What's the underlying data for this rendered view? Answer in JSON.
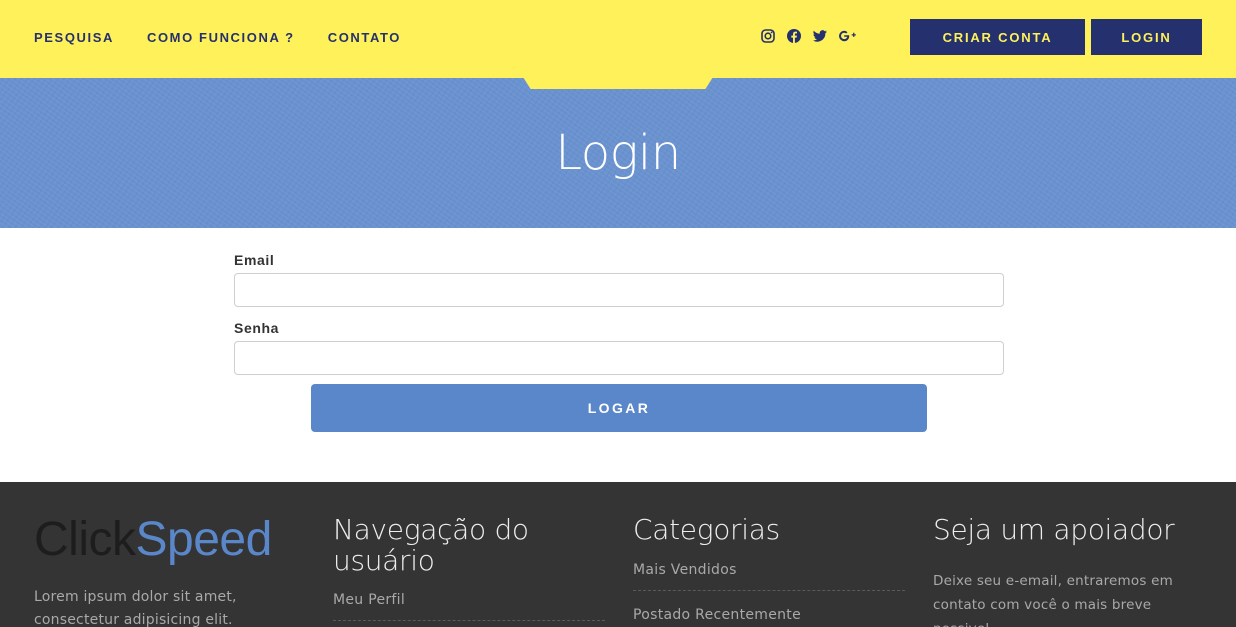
{
  "header": {
    "nav": [
      "PESQUISA",
      "COMO FUNCIONA ?",
      "CONTATO"
    ],
    "social_icons": [
      "instagram-icon",
      "facebook-icon",
      "twitter-icon",
      "google-plus-icon"
    ],
    "create_account_label": "CRIAR CONTA",
    "login_label": "LOGIN",
    "colors": {
      "bar": "#fff15a",
      "accent": "#25306e"
    }
  },
  "hero": {
    "title": "Login",
    "color": "#6a92cf"
  },
  "form": {
    "email_label": "Email",
    "email_value": "",
    "password_label": "Senha",
    "password_value": "",
    "submit_label": "LOGAR",
    "submit_color": "#5a87c9"
  },
  "footer": {
    "brand_part1": "Click",
    "brand_part2": "Speed",
    "about": "Lorem ipsum dolor sit amet, consectetur adipisicing elit.",
    "nav_title": "Navegação do usuário",
    "nav_links": [
      "Meu Perfil"
    ],
    "categories_title": "Categorias",
    "categories_links": [
      "Mais Vendidos",
      "Postado Recentemente"
    ],
    "support_title": "Seja um apoiador",
    "support_text": "Deixe seu e-email, entraremos em contato com você o mais breve possivel.",
    "background": "#343434"
  }
}
